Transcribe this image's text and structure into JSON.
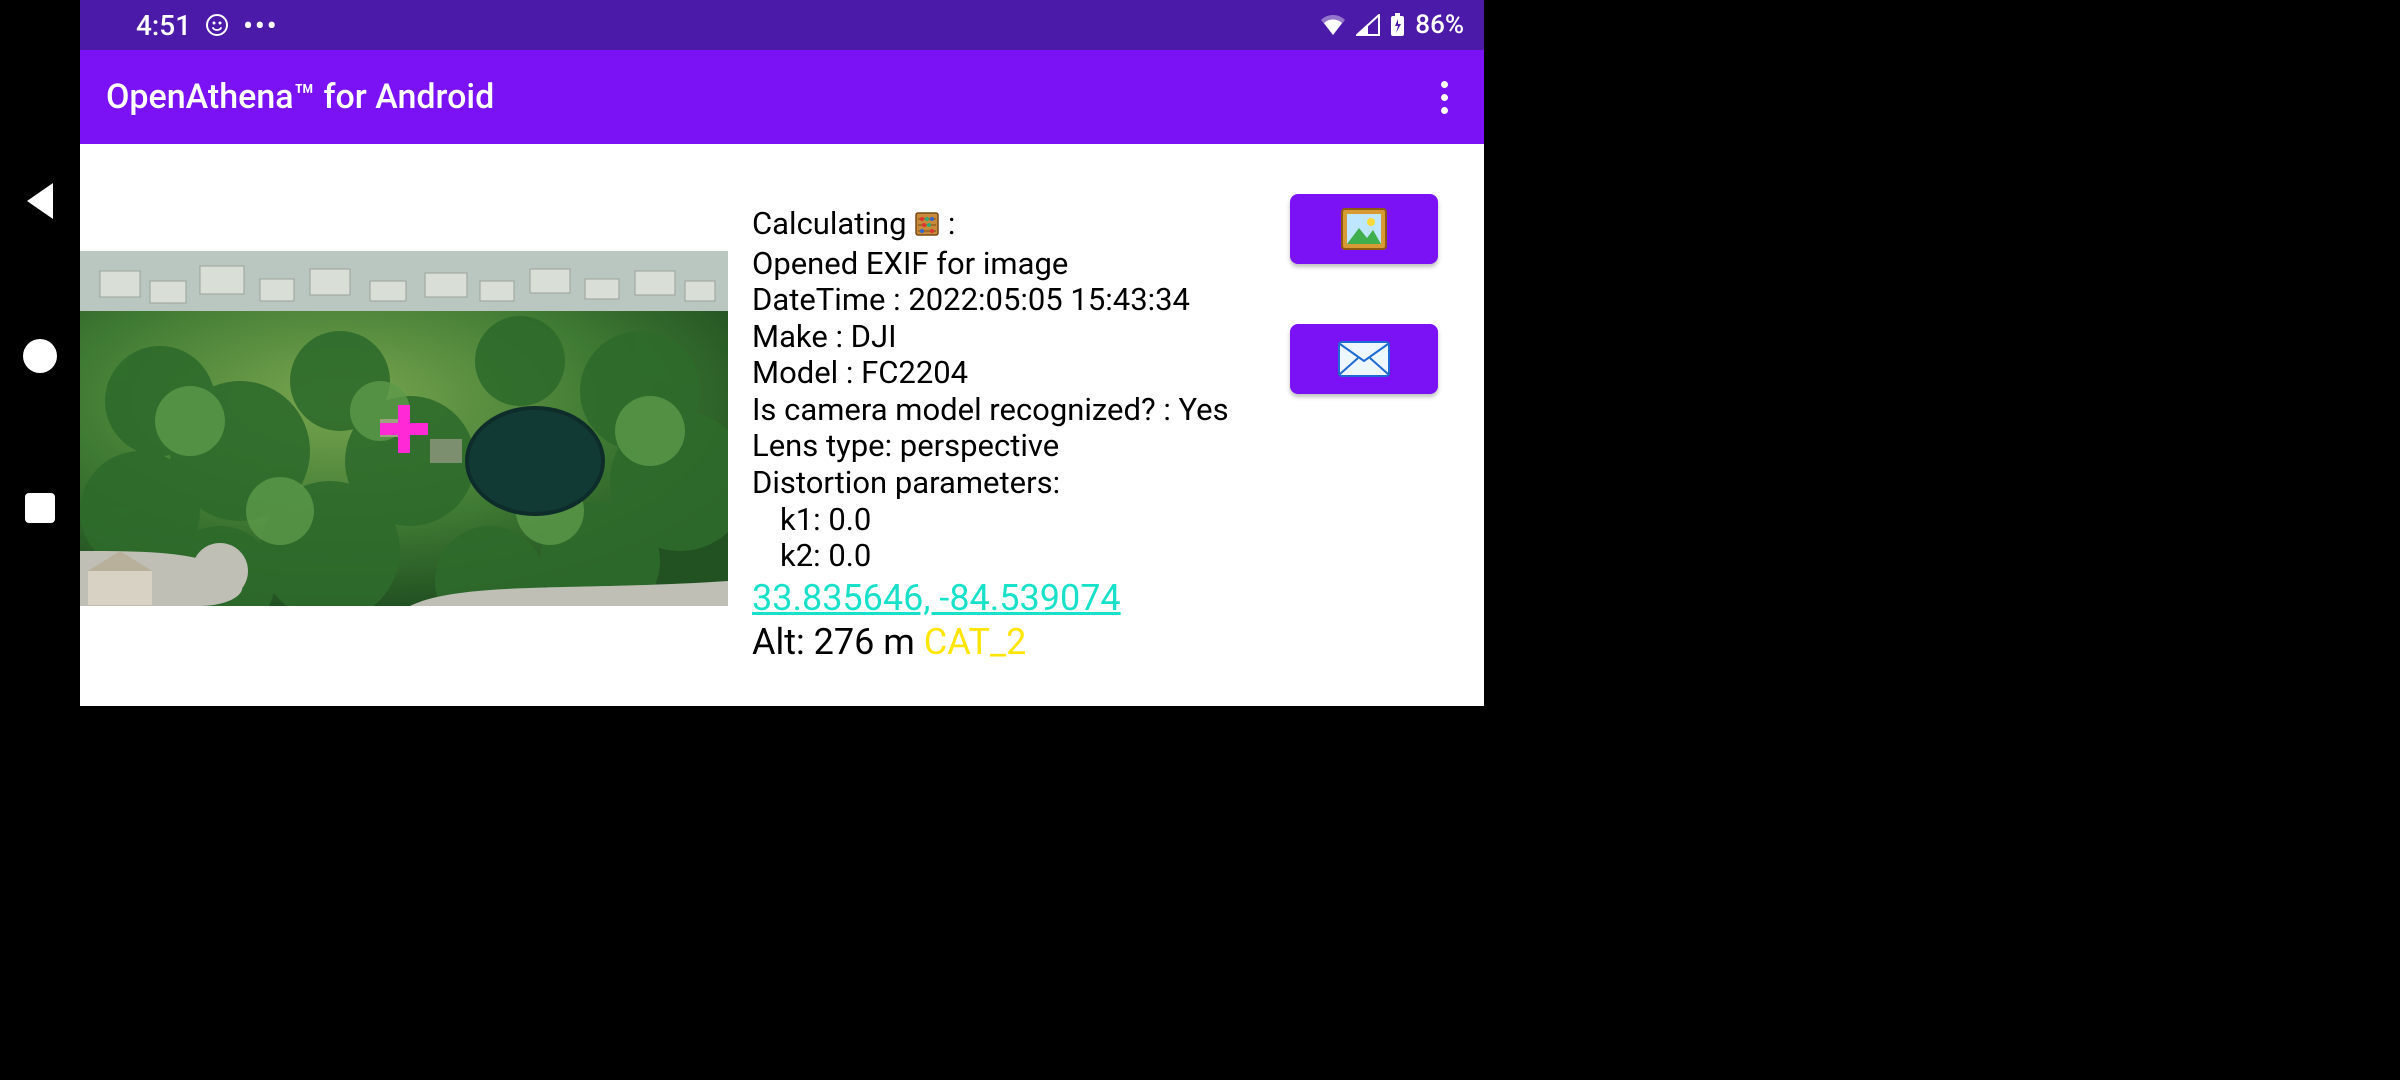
{
  "status_bar": {
    "clock": "4:51",
    "battery_text": "86%"
  },
  "app_bar": {
    "title": "OpenAthena™ for Android"
  },
  "readout": {
    "calculating_label": "Calculating ",
    "calculating_suffix": ":",
    "opened_exif": "Opened EXIF for image",
    "datetime_line": "DateTime : 2022:05:05 15:43:34",
    "make_line": "Make : DJI",
    "model_line": "Model : FC2204",
    "recognized_line": "Is camera model recognized? : Yes",
    "lens_line": "Lens type: perspective",
    "distortion_header": "Distortion parameters:",
    "k1_line": "k1: 0.0",
    "k2_line": "k2: 0.0",
    "coord_text": "33.835646, -84.539074",
    "alt_prefix": "Alt: 276 m ",
    "alt_cat": "CAT_2"
  }
}
